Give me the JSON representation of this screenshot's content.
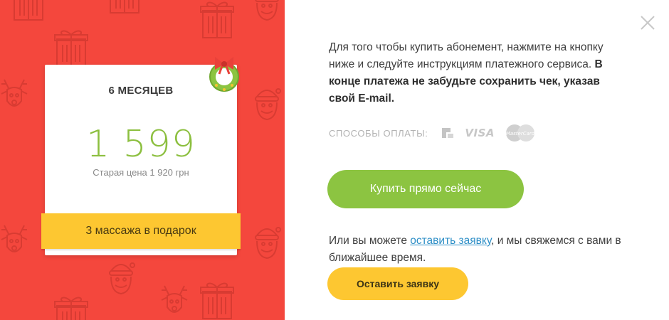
{
  "offer": {
    "period": "6 МЕСЯЦЕВ",
    "price": "1 599",
    "old_price": "Старая цена 1 920 грн",
    "gift": "3 массажа в подарок"
  },
  "info": {
    "text_regular": "Для того чтобы купить абонемент, нажмите на кнопку ниже и следуйте инструкциям платежного сервиса.",
    "text_bold": "В конце платежа не забудьте сохранить чек, указав свой E-mail."
  },
  "payment": {
    "label": "СПОСОБЫ ОПЛАТЫ:",
    "icons": [
      "privatbank-icon",
      "visa-icon",
      "mastercard-icon"
    ],
    "visa_text": "VISA",
    "mastercard_text": "MasterCard"
  },
  "buy_button": {
    "label": "Купить прямо сейчас"
  },
  "request": {
    "text_before": "Или вы можете",
    "link": "оставить заявку",
    "text_after": ", и мы свяжемся с вами в ближайшее время.",
    "button_label": "Оставить заявку"
  },
  "colors": {
    "panel_red": "#f4473d",
    "price_green": "#8cbf3f",
    "button_green": "#8cc441",
    "button_yellow": "#fdc731",
    "link_blue": "#2e8fc7"
  }
}
